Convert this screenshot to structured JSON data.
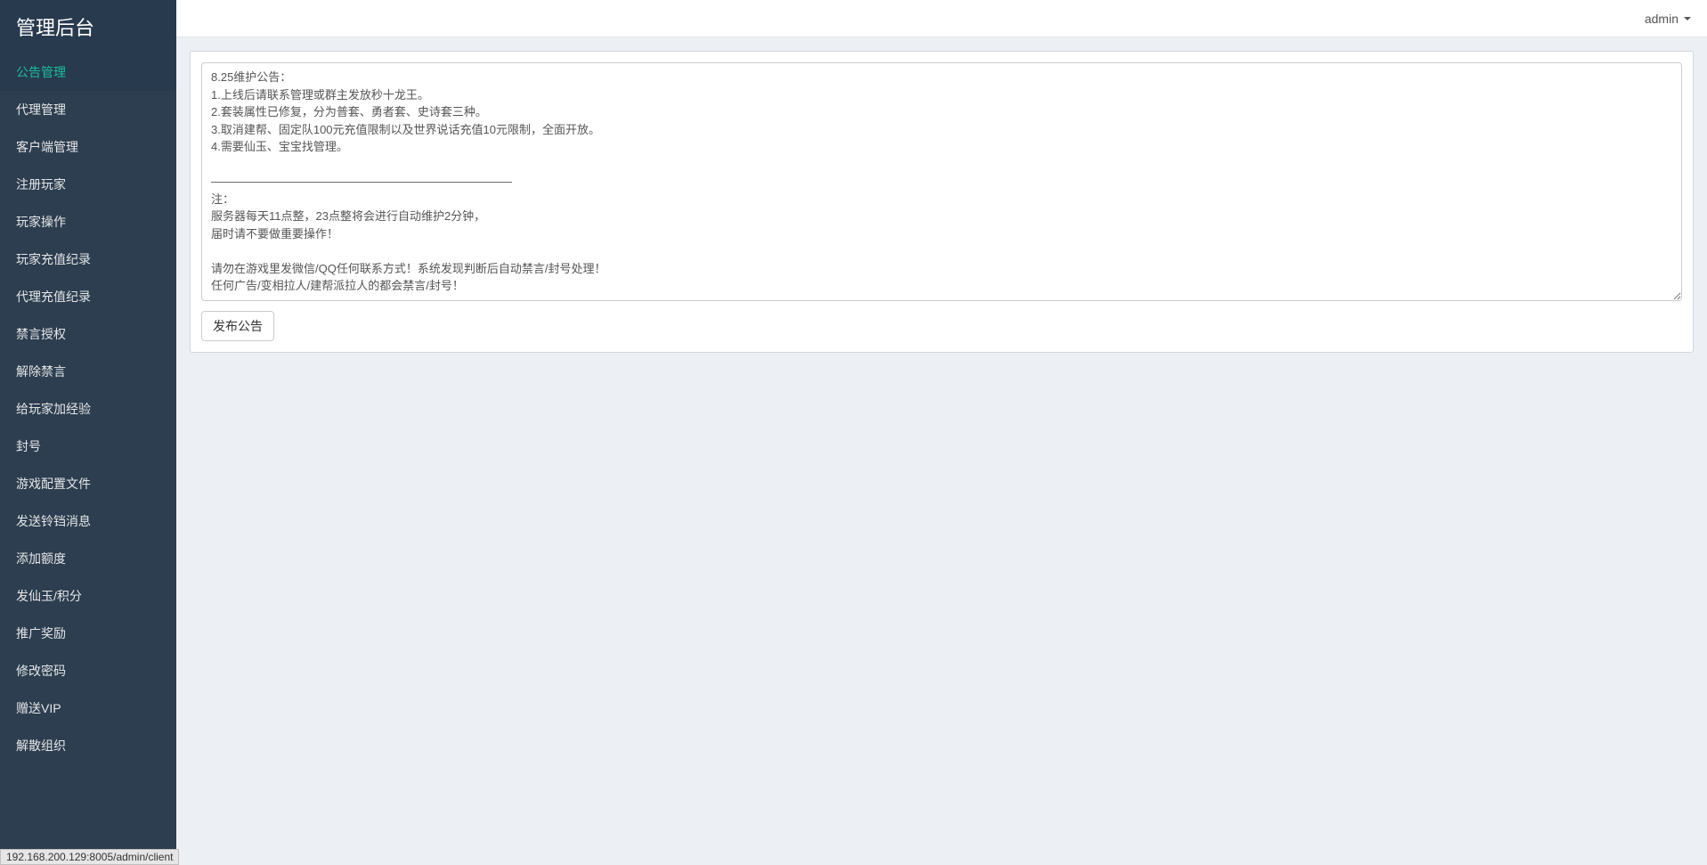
{
  "brand": "管理后台",
  "user_menu_label": "admin",
  "sidebar": {
    "items": [
      {
        "label": "公告管理",
        "active": true
      },
      {
        "label": "代理管理",
        "active": false
      },
      {
        "label": "客户端管理",
        "active": false
      },
      {
        "label": "注册玩家",
        "active": false
      },
      {
        "label": "玩家操作",
        "active": false
      },
      {
        "label": "玩家充值纪录",
        "active": false
      },
      {
        "label": "代理充值纪录",
        "active": false
      },
      {
        "label": "禁言授权",
        "active": false
      },
      {
        "label": "解除禁言",
        "active": false
      },
      {
        "label": "给玩家加经验",
        "active": false
      },
      {
        "label": "封号",
        "active": false
      },
      {
        "label": "游戏配置文件",
        "active": false
      },
      {
        "label": "发送铃铛消息",
        "active": false
      },
      {
        "label": "添加额度",
        "active": false
      },
      {
        "label": "发仙玉/积分",
        "active": false
      },
      {
        "label": "推广奖励",
        "active": false
      },
      {
        "label": "修改密码",
        "active": false
      },
      {
        "label": "赠送VIP",
        "active": false
      },
      {
        "label": "解散组织",
        "active": false
      }
    ]
  },
  "main": {
    "announcement_text": "8.25维护公告：\n1.上线后请联系管理或群主发放秒十龙王。\n2.套装属性已修复，分为普套、勇者套、史诗套三种。\n3.取消建帮、固定队100元充值限制以及世界说话充值10元限制，全面开放。\n4.需要仙玉、宝宝找管理。\n\n——————————————————————————\n注：\n服务器每天11点整，23点整将会进行自动维护2分钟，\n届时请不要做重要操作！\n\n请勿在游戏里发微信/QQ任何联系方式！系统发现判断后自动禁言/封号处理！\n任何广告/变相拉人/建帮派拉人的都会禁言/封号！",
    "publish_button_label": "发布公告"
  },
  "status_bar_text": "192.168.200.129:8005/admin/client"
}
